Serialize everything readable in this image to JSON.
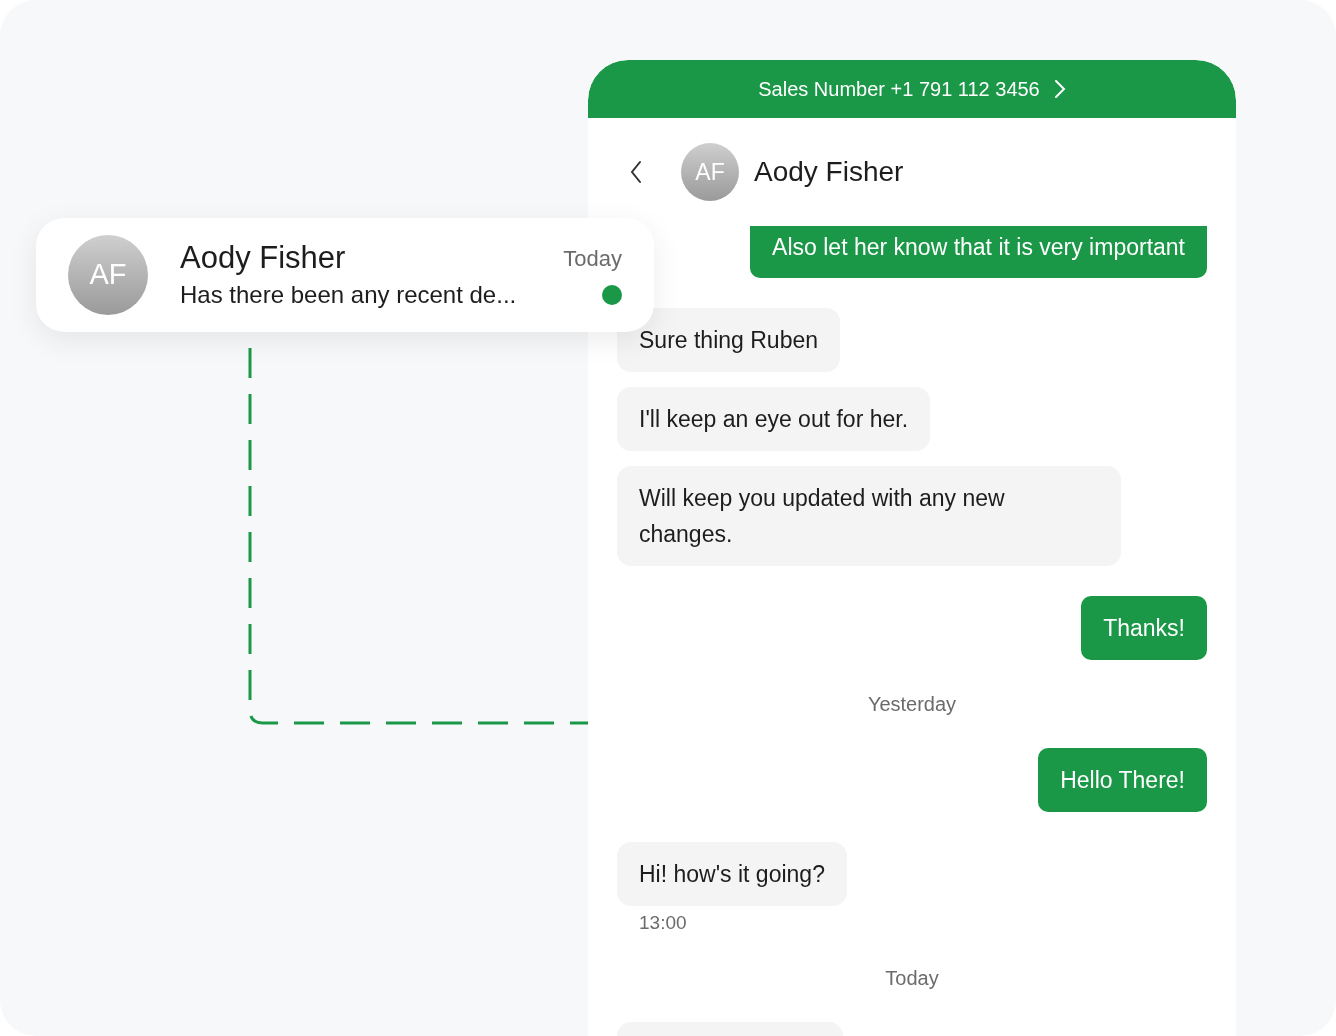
{
  "notification_card": {
    "avatar_initials": "AF",
    "name": "Aody Fisher",
    "time": "Today",
    "preview": "Has there been any recent de...",
    "unread": true
  },
  "chat": {
    "banner": {
      "label": "Sales Number +1 791 112 3456"
    },
    "contact": {
      "avatar_initials": "AF",
      "name": "Aody Fisher"
    },
    "messages": [
      {
        "kind": "outgoing",
        "text": "Also let her know that it is very important"
      },
      {
        "kind": "incoming",
        "text": "Sure thing Ruben"
      },
      {
        "kind": "incoming",
        "text": "I'll keep an eye out for her."
      },
      {
        "kind": "incoming",
        "text": "Will keep you updated with any new changes."
      },
      {
        "kind": "outgoing",
        "text": "Thanks!"
      },
      {
        "kind": "date",
        "text": "Yesterday"
      },
      {
        "kind": "outgoing",
        "text": "Hello There!"
      },
      {
        "kind": "incoming",
        "text": "Hi! how's it going?"
      },
      {
        "kind": "time",
        "text": "13:00"
      },
      {
        "kind": "date",
        "text": "Today"
      },
      {
        "kind": "incoming"
      }
    ]
  }
}
